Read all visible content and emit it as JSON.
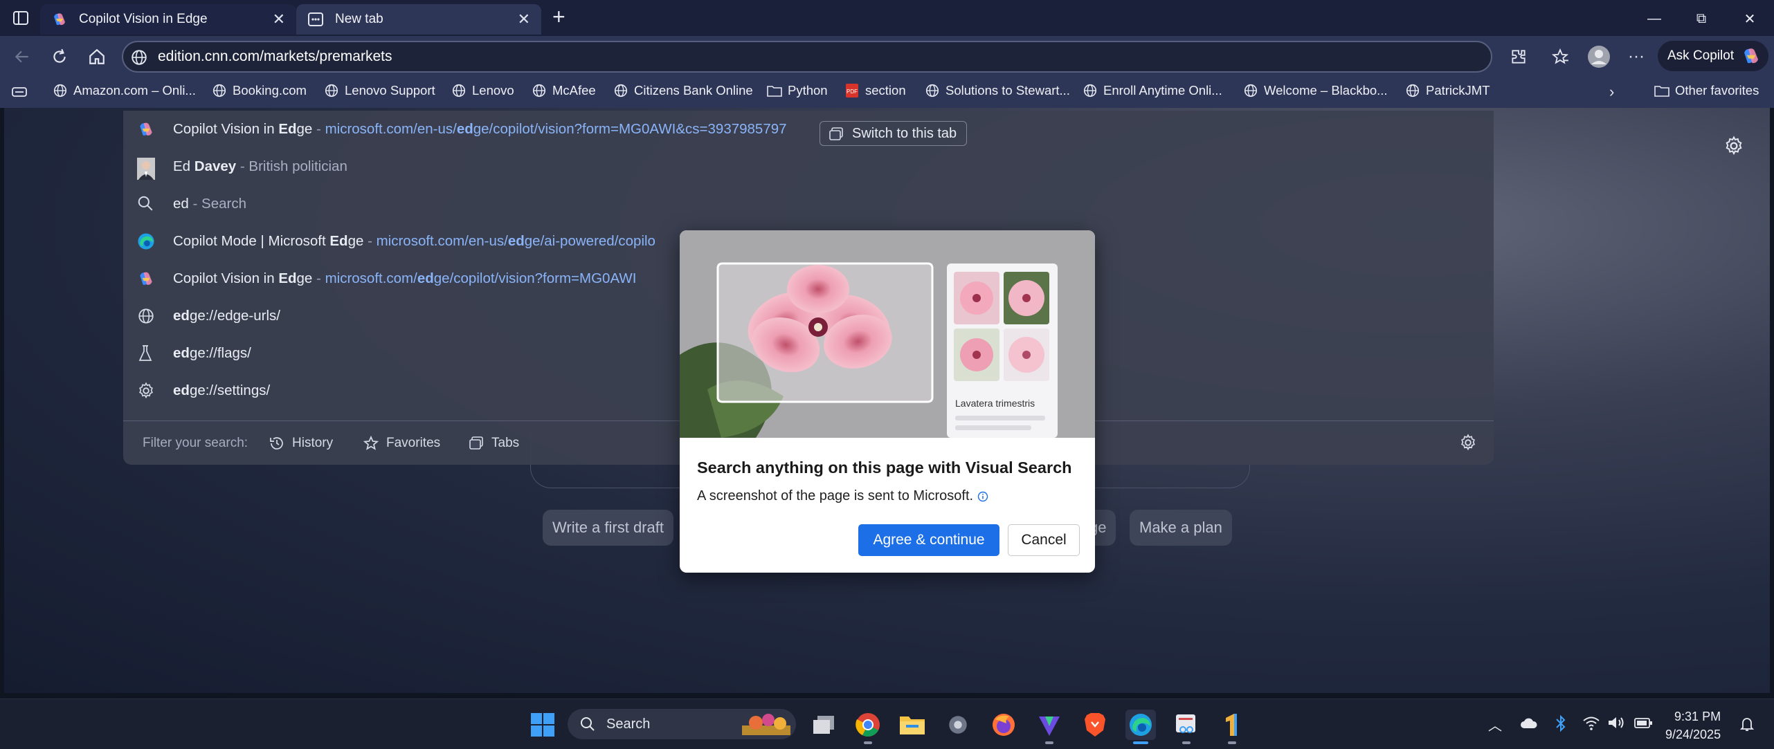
{
  "tabs": [
    {
      "label": "Copilot Vision in Edge",
      "close": "✕"
    },
    {
      "label": "New tab",
      "close": "✕"
    }
  ],
  "new_tab_symbol": "+",
  "window_controls": {
    "minimize": "—",
    "restore": "⧉",
    "close": "✕"
  },
  "address_bar": {
    "url": "edition.cnn.com/markets/premarkets"
  },
  "toolbar": {
    "ask_copilot": "Ask Copilot",
    "more": "···"
  },
  "favorites": [
    {
      "label": "Amazon.com – Onli...",
      "icon": "globe-icon"
    },
    {
      "label": "Booking.com",
      "icon": "globe-icon"
    },
    {
      "label": "Lenovo Support",
      "icon": "globe-icon"
    },
    {
      "label": "Lenovo",
      "icon": "globe-icon"
    },
    {
      "label": "McAfee",
      "icon": "globe-icon"
    },
    {
      "label": "Citizens Bank Online",
      "icon": "globe-icon"
    },
    {
      "label": "Python",
      "icon": "folder-icon"
    },
    {
      "label": "section",
      "icon": "pdf-icon"
    },
    {
      "label": "Solutions to Stewart...",
      "icon": "globe-icon"
    },
    {
      "label": "Enroll Anytime Onli...",
      "icon": "globe-icon"
    },
    {
      "label": "Welcome – Blackbo...",
      "icon": "globe-icon"
    },
    {
      "label": "PatrickJMT",
      "icon": "globe-icon"
    }
  ],
  "other_favorites": "Other favorites",
  "suggestions": [
    {
      "pre": "Copilot Vision in ",
      "bold": "Ed",
      "post": "ge",
      "dash": " - ",
      "url_pre": "microsoft.com/en-us/",
      "url_bold": "ed",
      "url_post": "ge/copilot/vision?form=MG0AWI&cs=3937985797",
      "icon": "copilot-icon"
    },
    {
      "pre": "Ed ",
      "bold": "Davey",
      "post": "",
      "dash": " - ",
      "sub": "British politician",
      "icon": "person-photo-icon"
    },
    {
      "pre": "ed",
      "bold": "",
      "post": "",
      "dash": " - ",
      "sub": "Search",
      "icon": "search-icon"
    },
    {
      "pre": "Copilot Mode | Microsoft ",
      "bold": "Ed",
      "post": "ge",
      "dash": " - ",
      "url_pre": "microsoft.com/en-us/",
      "url_bold": "ed",
      "url_post": "ge/ai-powered/copilo",
      "icon": "edge-icon"
    },
    {
      "pre": "Copilot Vision in ",
      "bold": "Ed",
      "post": "ge",
      "dash": " - ",
      "url_pre": "microsoft.com/",
      "url_bold": "ed",
      "url_post": "ge/copilot/vision?form=MG0AWI",
      "icon": "copilot-icon"
    },
    {
      "pre": "",
      "bold": "ed",
      "post": "ge://edge-urls/",
      "icon": "globe-icon"
    },
    {
      "pre": "",
      "bold": "ed",
      "post": "ge://flags/",
      "icon": "flask-icon"
    },
    {
      "pre": "",
      "bold": "ed",
      "post": "ge://settings/",
      "icon": "gear-icon"
    }
  ],
  "switch_tab_label": "Switch to this tab",
  "filter": {
    "label": "Filter your search:",
    "history": "History",
    "favorites": "Favorites",
    "tabs": "Tabs"
  },
  "prompt_pills": [
    "Write a first draft",
    "ge",
    "Make a plan"
  ],
  "modal": {
    "image_caption": "Lavatera trimestris",
    "title": "Search anything on this page with Visual Search",
    "description": "A screenshot of the page is sent to Microsoft.",
    "agree": "Agree & continue",
    "cancel": "Cancel"
  },
  "taskbar": {
    "search_placeholder": "Search",
    "apps": [
      "windows-start-icon",
      "task-view-icon",
      "chrome-icon",
      "file-explorer-icon",
      "settings-icon",
      "firefox-icon",
      "vpn-icon",
      "brave-icon",
      "edge-icon",
      "snipping-tool-icon",
      "app-one-icon"
    ],
    "time": "9:31 PM",
    "date": "9/24/2025"
  }
}
